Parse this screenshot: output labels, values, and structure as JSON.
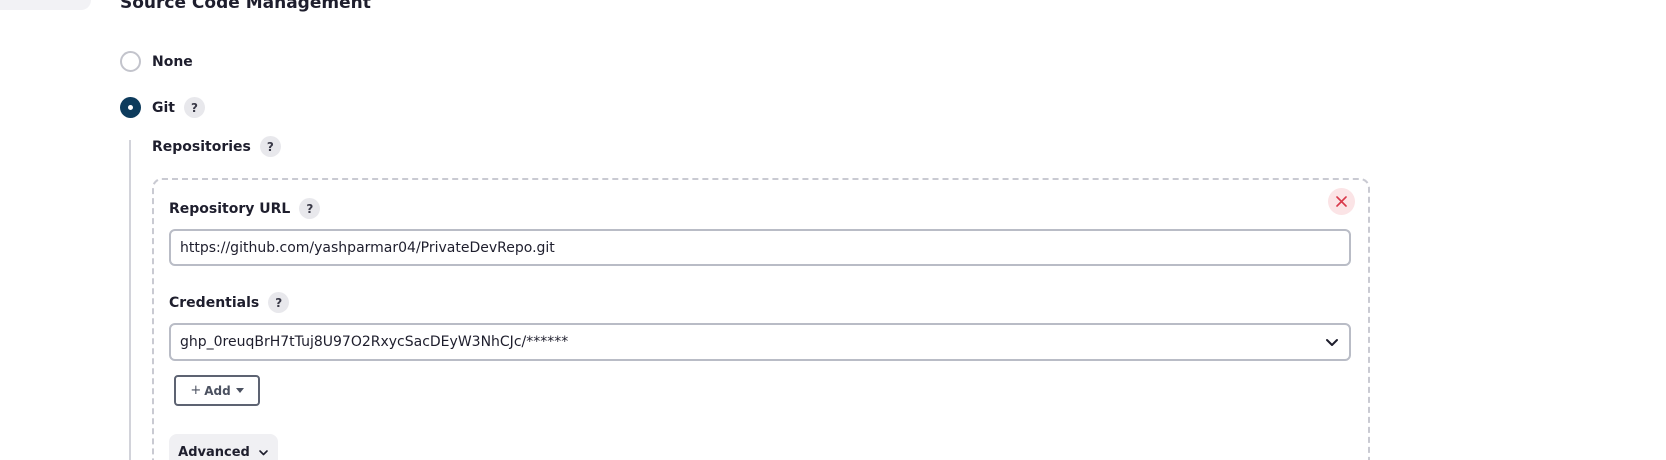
{
  "section": {
    "title": "Source Code Management"
  },
  "scm_options": {
    "none_label": "None",
    "git_label": "Git",
    "selected": "Git"
  },
  "git": {
    "repositories_label": "Repositories",
    "repository_url": {
      "label": "Repository URL",
      "value": "https://github.com/yashparmar04/PrivateDevRepo.git"
    },
    "credentials": {
      "label": "Credentials",
      "selected_value": "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/******"
    },
    "add_button": {
      "label": "Add"
    },
    "advanced_button": {
      "label": "Advanced"
    },
    "help_icon_text": "?"
  },
  "icons": {
    "help": "question-mark",
    "delete": "close-x",
    "select_chevron": "chevron-down",
    "advanced_chevron": "chevron-down",
    "add_caret": "caret-down"
  },
  "colors": {
    "selected_radio": "#0d3b5c",
    "delete_bg": "#fbe4e6",
    "delete_icon": "#d8394a"
  }
}
